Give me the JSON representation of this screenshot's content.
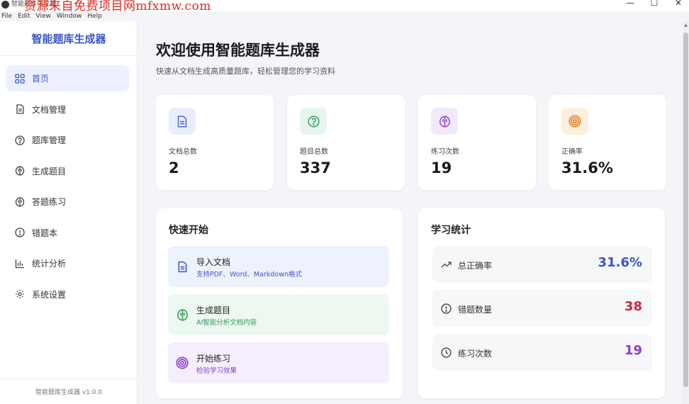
{
  "window": {
    "title": "智能题库生成器",
    "watermark": "资源来自免费项目网mfxmw.com",
    "minimize": "—",
    "maximize": "☐",
    "close": "✕"
  },
  "menu": [
    "File",
    "Edit",
    "View",
    "Window",
    "Help"
  ],
  "sidebar": {
    "brand": "智能题库生成器",
    "items": [
      {
        "label": "首页",
        "icon": "dashboard-icon"
      },
      {
        "label": "文档管理",
        "icon": "document-icon"
      },
      {
        "label": "题库管理",
        "icon": "question-icon"
      },
      {
        "label": "生成题目",
        "icon": "brain-icon"
      },
      {
        "label": "答题练习",
        "icon": "brain-icon"
      },
      {
        "label": "错题本",
        "icon": "alert-icon"
      },
      {
        "label": "统计分析",
        "icon": "bar-chart-icon"
      },
      {
        "label": "系统设置",
        "icon": "gear-icon"
      }
    ],
    "version": "智能题库生成器 v1.0.0"
  },
  "header": {
    "title": "欢迎使用智能题库生成器",
    "subtitle": "快速从文档生成高质量题库，轻松管理您的学习资料"
  },
  "stats": [
    {
      "label": "文档总数",
      "value": "2",
      "icon": "document-icon",
      "color": "#4a63d8",
      "bg": "#eaeefc"
    },
    {
      "label": "题目总数",
      "value": "337",
      "icon": "question-icon",
      "color": "#2f9a5a",
      "bg": "#e6f6ec"
    },
    {
      "label": "练习次数",
      "value": "19",
      "icon": "brain-icon",
      "color": "#8a3fd1",
      "bg": "#f2e9fb"
    },
    {
      "label": "正确率",
      "value": "31.6%",
      "icon": "target-icon",
      "color": "#e07a24",
      "bg": "#fdeedd"
    }
  ],
  "quick_start": {
    "title": "快速开始",
    "items": [
      {
        "title": "导入文档",
        "desc": "支持PDF、Word、Markdown格式",
        "icon": "document-icon",
        "color": "#3b55c8",
        "bg": "#eef2fd"
      },
      {
        "title": "生成题目",
        "desc": "AI智能分析文档内容",
        "icon": "brain-icon",
        "color": "#2f9a5a",
        "bg": "#ecf8f0"
      },
      {
        "title": "开始练习",
        "desc": "检验学习效果",
        "icon": "target-icon",
        "color": "#8a3fd1",
        "bg": "#f5eefc"
      }
    ]
  },
  "learning_stats": {
    "title": "学习统计",
    "items": [
      {
        "label": "总正确率",
        "value": "31.6%",
        "icon": "trend-up-icon",
        "color": "#3b55c8"
      },
      {
        "label": "错题数量",
        "value": "38",
        "icon": "alert-icon",
        "color": "#c8283a"
      },
      {
        "label": "练习次数",
        "value": "19",
        "icon": "clock-icon",
        "color": "#8a3fd1"
      }
    ]
  }
}
